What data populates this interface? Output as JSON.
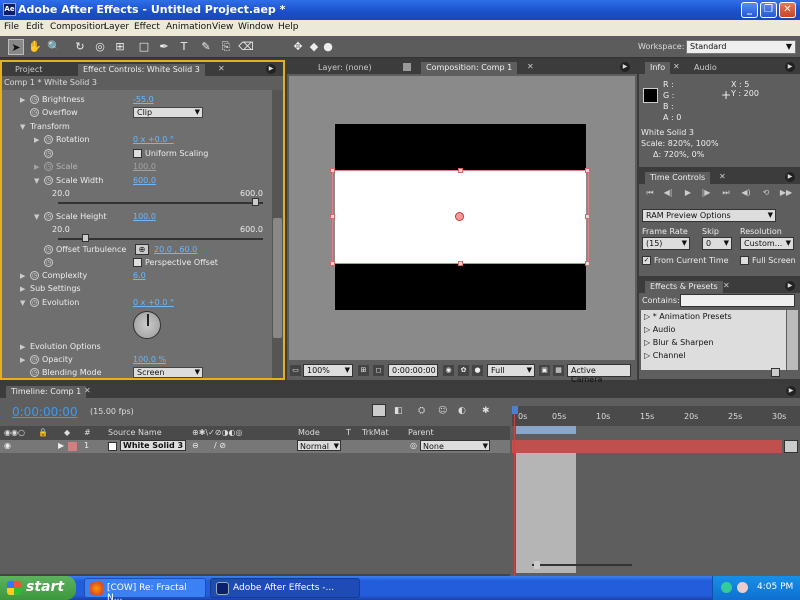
{
  "window": {
    "title": "Adobe After Effects - Untitled Project.aep *",
    "icon_text": "Ae"
  },
  "menu": [
    "File",
    "Edit",
    "Composition",
    "Layer",
    "Effect",
    "Animation",
    "View",
    "Window",
    "Help"
  ],
  "workspace": {
    "label": "Workspace:",
    "value": "Standard"
  },
  "project_tab": "Project",
  "effect_controls": {
    "tab": "Effect Controls: White Solid 3",
    "breadcrumb": "Comp 1 * White Solid 3",
    "rows": {
      "brightness": {
        "name": "Brightness",
        "value": "-55.0"
      },
      "overflow": {
        "name": "Overflow",
        "value": "Clip"
      },
      "transform": {
        "name": "Transform"
      },
      "rotation": {
        "name": "Rotation",
        "value": "0 x +0.0 °"
      },
      "uniform_scaling": {
        "label": "Uniform Scaling"
      },
      "scale": {
        "name": "Scale",
        "value": "100.0"
      },
      "scale_width": {
        "name": "Scale Width",
        "value": "600.0",
        "min": "20.0",
        "max": "600.0"
      },
      "scale_height": {
        "name": "Scale Height",
        "value": "100.0",
        "min": "20.0",
        "max": "600.0"
      },
      "offset_turbulence": {
        "name": "Offset Turbulence",
        "value": "20.0 , 60.0"
      },
      "perspective_offset": {
        "label": "Perspective Offset"
      },
      "complexity": {
        "name": "Complexity",
        "value": "6.0"
      },
      "sub_settings": {
        "name": "Sub Settings"
      },
      "evolution": {
        "name": "Evolution",
        "value": "0 x +0.0 °"
      },
      "evolution_options": {
        "name": "Evolution Options"
      },
      "opacity": {
        "name": "Opacity",
        "value": "100.0 %"
      },
      "blending_mode": {
        "name": "Blending Mode",
        "value": "Screen"
      }
    }
  },
  "composition": {
    "layer_tab": "Layer: (none)",
    "comp_tab": "Composition: Comp 1",
    "zoom": "100%",
    "timecode": "0:00:00:00",
    "resolution": "Full",
    "camera": "Active Camera"
  },
  "info": {
    "tab": "Info",
    "audio_tab": "Audio",
    "r": "R :",
    "g": "G :",
    "b": "B :",
    "a": "A : 0",
    "x": "X : 5",
    "y": "Y : 200",
    "layer_name": "White Solid 3",
    "scale": "Scale: 820%, 100%",
    "delta": "Δ: 720%, 0%"
  },
  "time_controls": {
    "tab": "Time Controls",
    "ram_preview": "RAM Preview Options",
    "frame_rate_label": "Frame Rate",
    "frame_rate": "(15)",
    "skip_label": "Skip",
    "skip": "0",
    "resolution_label": "Resolution",
    "resolution": "Custom...",
    "from_current_time": "From Current Time",
    "full_screen": "Full Screen"
  },
  "effects_presets": {
    "tab": "Effects & Presets",
    "contains_label": "Contains:",
    "items": [
      "* Animation Presets",
      "Audio",
      "Blur & Sharpen",
      "Channel"
    ]
  },
  "timeline": {
    "tab": "Timeline: Comp 1",
    "timecode": "0:00:00:00",
    "fps": "(15.00 fps)",
    "columns": {
      "num": "#",
      "source_name": "Source Name",
      "mode": "Mode",
      "t": "T",
      "trkmat": "TrkMat",
      "parent": "Parent"
    },
    "layer": {
      "num": "1",
      "name": "White Solid 3",
      "mode": "Normal",
      "parent": "None"
    },
    "ruler": [
      "0s",
      "05s",
      "10s",
      "15s",
      "20s",
      "25s",
      "30s"
    ]
  },
  "taskbar": {
    "start": "start",
    "tasks": [
      "[COW] Re: Fractal N...",
      "Adobe After Effects -..."
    ],
    "clock": "4:05 PM"
  },
  "colors": {
    "accent_border": "#e8b018",
    "layer_bar": "#c0504d",
    "cti": "#d04040"
  }
}
